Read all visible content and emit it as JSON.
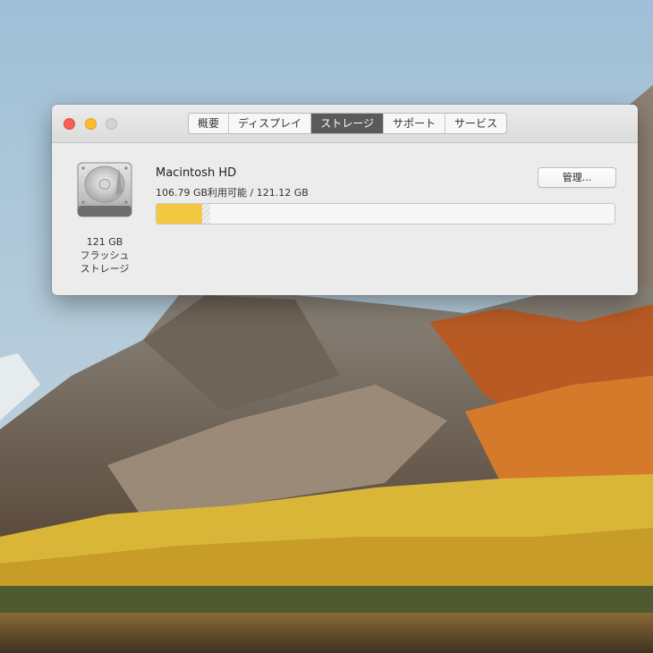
{
  "window": {
    "tabs": [
      {
        "label": "概要",
        "active": false
      },
      {
        "label": "ディスプレイ",
        "active": false
      },
      {
        "label": "ストレージ",
        "active": true
      },
      {
        "label": "サポート",
        "active": false
      },
      {
        "label": "サービス",
        "active": false
      }
    ]
  },
  "storage": {
    "drive_name": "Macintosh HD",
    "usage_text": "106.79 GB利用可能 / 121.12 GB",
    "manage_label": "管理...",
    "capacity_label": "121 GB",
    "type_line1": "フラッシュ",
    "type_line2": "ストレージ",
    "used_fraction": 0.1,
    "other_fraction": 0.018,
    "used_color": "#f5c842"
  },
  "icons": {
    "drive": "hard-drive-icon"
  }
}
